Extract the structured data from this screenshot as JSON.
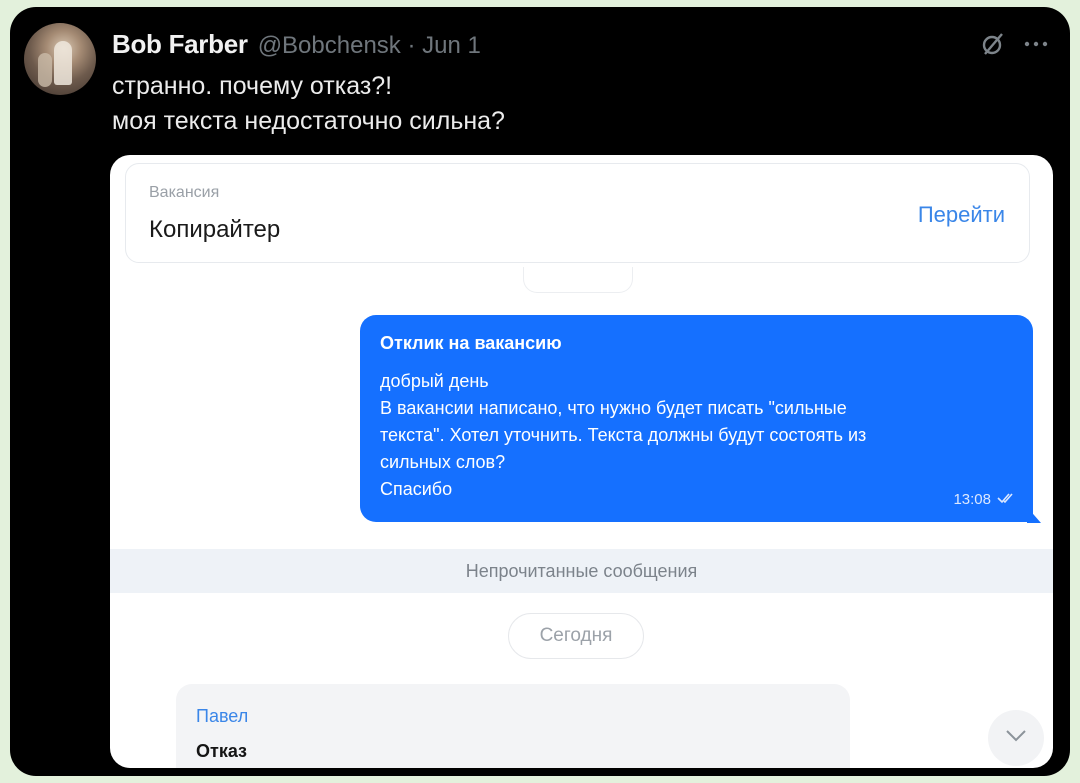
{
  "tweet": {
    "author_name": "Bob Farber",
    "handle_date": "@Bobchensk · Jun 1",
    "text_lines": [
      "странно. почему отказ?!",
      "моя текста недостаточно сильна?"
    ]
  },
  "screenshot": {
    "vacancy": {
      "label": "Вакансия",
      "title": "Копирайтер",
      "link": "Перейти"
    },
    "outgoing_message": {
      "title": "Отклик на вакансию",
      "lines": [
        "добрый день",
        "В вакансии написано, что нужно будет писать \"сильные",
        "текста\". Хотел уточнить. Текста должны будут состоять из",
        "сильных слов?",
        "Спасибо"
      ],
      "time": "13:08"
    },
    "unread_label": "Непрочитанные сообщения",
    "date_label": "Сегодня",
    "incoming_message": {
      "author": "Павел",
      "text": "Отказ"
    }
  },
  "colors": {
    "accent": "#1570ff",
    "link": "#3a86e8",
    "page_bg": "#e3f1dc"
  },
  "icons": [
    "grok-icon",
    "more-icon",
    "read-checkmarks-icon",
    "chevron-down-icon"
  ]
}
